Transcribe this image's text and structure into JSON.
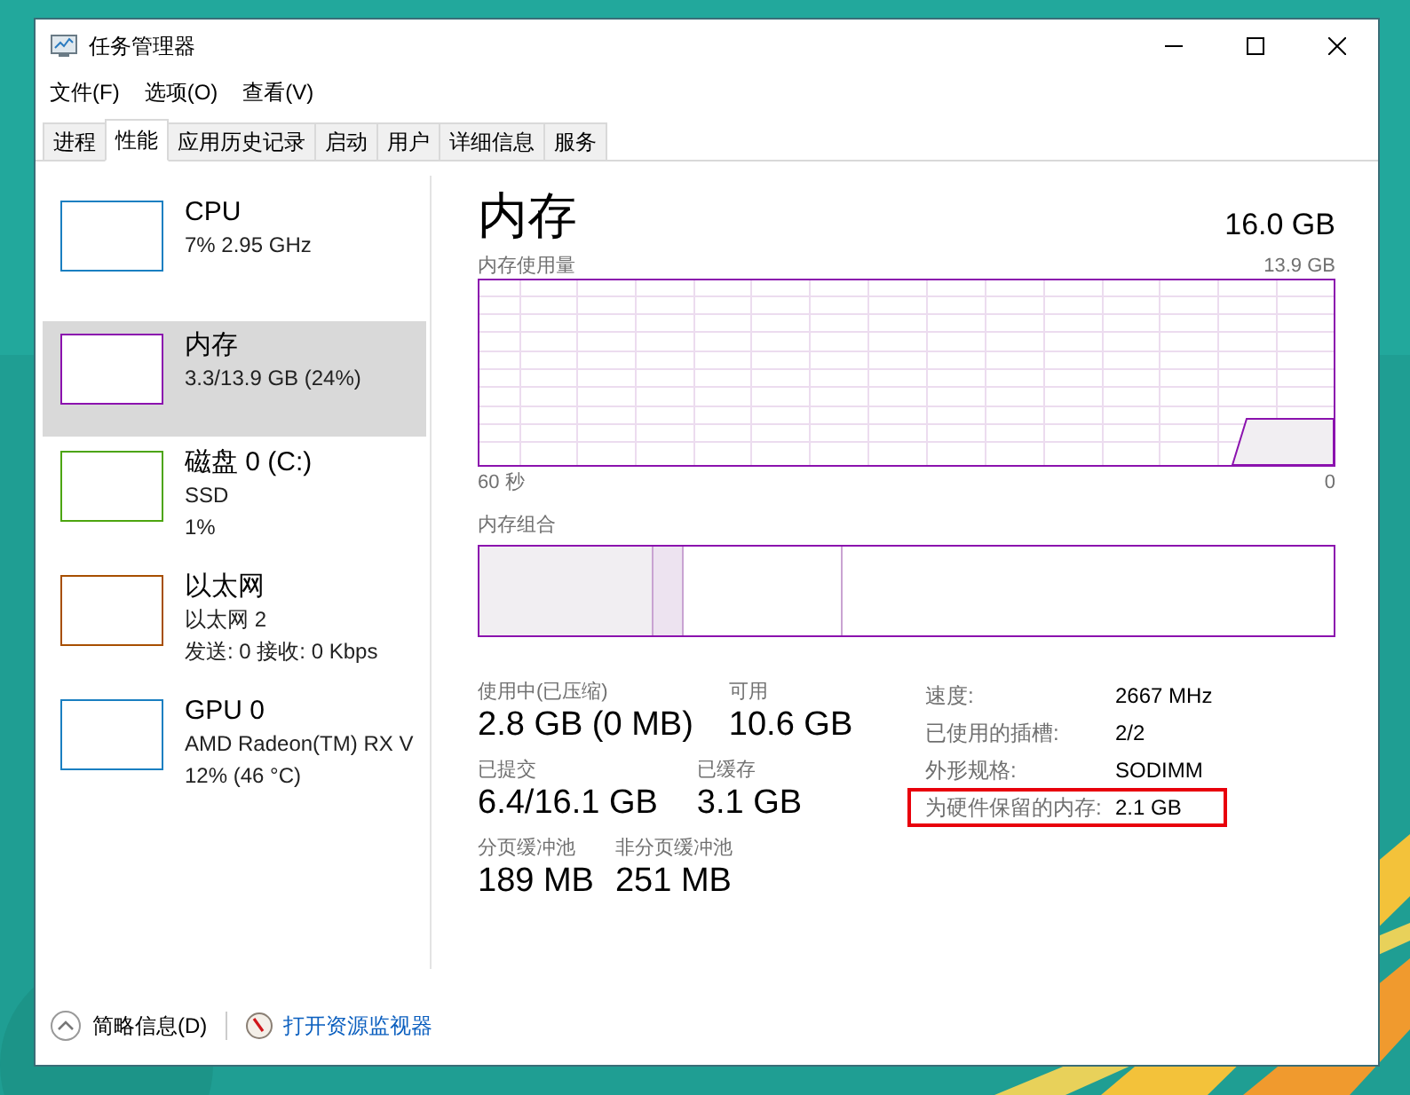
{
  "window": {
    "title": "任务管理器"
  },
  "menu": [
    "文件(F)",
    "选项(O)",
    "查看(V)"
  ],
  "tabs": [
    {
      "label": "进程",
      "selected": false
    },
    {
      "label": "性能",
      "selected": true
    },
    {
      "label": "应用历史记录",
      "selected": false
    },
    {
      "label": "启动",
      "selected": false
    },
    {
      "label": "用户",
      "selected": false
    },
    {
      "label": "详细信息",
      "selected": false
    },
    {
      "label": "服务",
      "selected": false
    }
  ],
  "sidebar": {
    "items": [
      {
        "title": "CPU",
        "lines": [
          "7% 2.95 GHz"
        ],
        "color": "#1a7fc1",
        "selected": false
      },
      {
        "title": "内存",
        "lines": [
          "3.3/13.9 GB (24%)"
        ],
        "color": "#8b12ae",
        "selected": true
      },
      {
        "title": "磁盘 0 (C:)",
        "lines": [
          "SSD",
          "1%"
        ],
        "color": "#4ca50f",
        "selected": false
      },
      {
        "title": "以太网",
        "lines": [
          "以太网 2",
          "发送: 0 接收: 0 Kbps"
        ],
        "color": "#a74f01",
        "selected": false
      },
      {
        "title": "GPU 0",
        "lines": [
          "AMD Radeon(TM) RX V",
          "12% (46 °C)"
        ],
        "color": "#1a7fc1",
        "selected": false
      }
    ]
  },
  "detail": {
    "title": "内存",
    "total": "16.0 GB",
    "usage_label": "内存使用量",
    "usage_max": "13.9 GB",
    "time_start": "60 秒",
    "time_end": "0",
    "composition_label": "内存组合",
    "stats": [
      [
        {
          "label": "使用中(已压缩)",
          "value": "2.8 GB (0 MB)"
        },
        {
          "label": "可用",
          "value": "10.6 GB"
        }
      ],
      [
        {
          "label": "已提交",
          "value": "6.4/16.1 GB"
        },
        {
          "label": "已缓存",
          "value": "3.1 GB"
        }
      ],
      [
        {
          "label": "分页缓冲池",
          "value": "189 MB"
        },
        {
          "label": "非分页缓冲池",
          "value": "251 MB"
        }
      ]
    ],
    "specs": [
      {
        "label": "速度:",
        "value": "2667 MHz",
        "highlighted": false
      },
      {
        "label": "已使用的插槽:",
        "value": "2/2",
        "highlighted": false
      },
      {
        "label": "外形规格:",
        "value": "SODIMM",
        "highlighted": false
      },
      {
        "label": "为硬件保留的内存:",
        "value": "2.1 GB",
        "highlighted": true
      }
    ]
  },
  "footer": {
    "details_toggle": "简略信息(D)",
    "monitor_link": "打开资源监视器"
  }
}
